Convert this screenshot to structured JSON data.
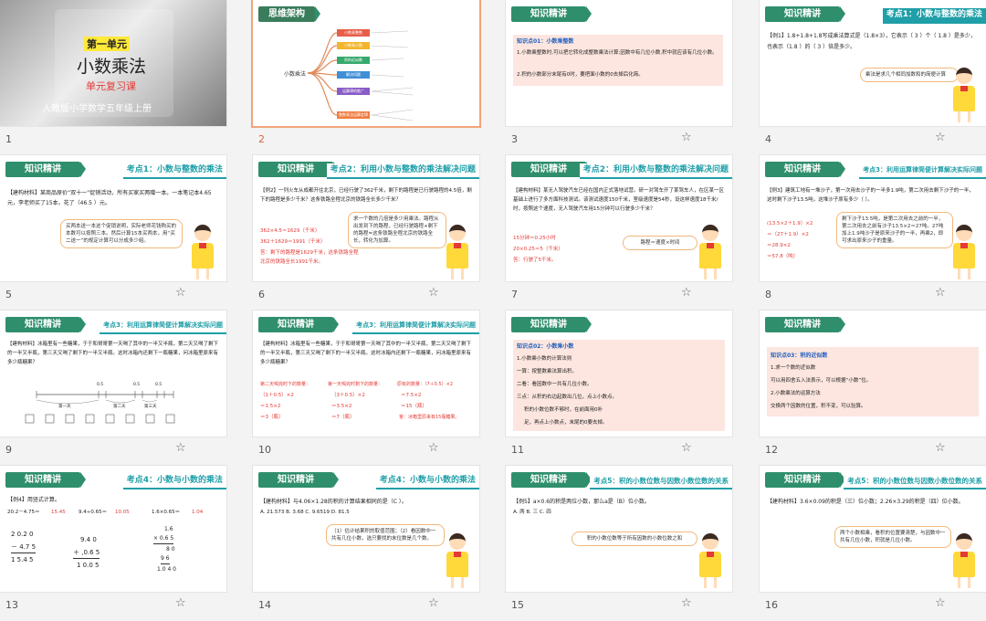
{
  "slides": [
    {
      "num": "1",
      "unit": "第一单元",
      "title": "小数乘法",
      "sub": "单元复习课",
      "pub": "人教版小学数学五年级上册"
    },
    {
      "num": "2",
      "header": "思维架构",
      "center": "小数乘法",
      "nodes": [
        "小数乘整数",
        "小数乘小数",
        "积的近似数",
        "解决问题",
        "运算律的推广",
        "整数乘法运算定律"
      ]
    },
    {
      "num": "3",
      "header": "知识精讲",
      "kp": "知识点01：小数乘整数",
      "lines": [
        "1.小数乘整数时,可以把它转化成整数乘法计算;因数中有几位小数,积中就应该有几位小数。",
        "2.积的小数部分末尾有0时，要把面小数的0去掉后化简。"
      ]
    },
    {
      "num": "4",
      "header": "知识精讲",
      "rtitle": "考点1：小数与整数的乘法",
      "q": "【例1】1.8+1.8+1.8写成乘法算式是（1.8×3），它表示（ 3 ）个（ 1.8 ）是多少，也表示（1.8 ）的（ 3 ）倍是多少。",
      "bubble": "乘法是求几个相同加数和的简便计算"
    },
    {
      "num": "5",
      "header": "知识精讲",
      "rtitle": "考点1：小数与整数的乘法",
      "q": "【建构材料】某商品原价“双十一”促销活动，所有买家买两赠一本。一本笔记本4.65元，李老师买了15本，花了（46.5 ）元。",
      "bubble": "买两本送一本这个促销说明，实际老师花钱购买的本数可以按照三本。然后计算15本买两本，用“买二送一”的规定计算可以分成多少组。"
    },
    {
      "num": "6",
      "header": "知识精讲",
      "rtitle": "考点2：利用小数与整数的乘法解决问题",
      "q": "【例2】一列火车从成都开往北京，已经行驶了362千米，剩下的路程是已行驶路程的4.5倍，剩下的路程是多少千米？这条铁路全程北京的铁路全长多少千米？",
      "a": [
        "362×4.5＝1629（千米）",
        "362＋1629＝1991（千米）",
        "答：剩下的路程是1629千米，这条铁路全程北京的铁路全长1991千米。"
      ],
      "bubble": "求一个数的几倍是多少用乘法。路程从出发到下的路程，已经行驶路程+剩下的路程=这条铁路全程北京的铁路全长，转化为加算。"
    },
    {
      "num": "7",
      "header": "知识精讲",
      "rtitle": "考点2：利用小数与整数的乘法解决问题",
      "q": "【建构材料】某无人驾驶汽车已经在国内正式落地试营。研一对驾车开了某驾车人，在区某一区基础上进行了多方面科技测试。该测试速度150千米，室级速度是54秒，设这样速度18千米/时，按照这个速度，无人驾驶汽车用15分钟可以行驶多少千米？",
      "a": [
        "15分钟＝0.25小时",
        "20×0.25＝5（千米）",
        "答：行驶了5千米。"
      ],
      "bubble": "路程＝速度×时间"
    },
    {
      "num": "8",
      "header": "知识精讲",
      "rtitle": "考点3：利用运算律简便计算解决实际问题",
      "q": "【例3】建筑工地有一堆沙子，第一次用去沙子的一半多1.9吨，第二次用去剩下沙子的一半，这时剩下沙子13.5吨，这堆沙子原有多少（ ）。",
      "a": [
        "(13.5×2＋1.9）×2",
        "＝（27＋1.9）×2",
        "＝28.9×2",
        "＝57.8（吨）"
      ],
      "bubble": "剩下沙子13.5吨，是第二次用去之前的一半，第二次用去之前有沙子13.5×2＝27吨。27吨加上1.9吨沙子是原来沙子的一半，再乘2，即可求出原来沙子的重量。"
    },
    {
      "num": "9",
      "header": "知识精讲",
      "rtitle": "考点3：利用运算律简便计算解决实际问题",
      "q": "【建构材料】冰箱里有一些糖果，于于和哥哥第一天喝了其中的一半又半瓶，第二天又喝了剩下的一半又半瓶，第三天又喝了剩下的一半又半瓶。这时冰箱内还剩下一瓶糖果，问冰箱里原来有多少瓶糖果？",
      "labels": [
        "第一天",
        "第二天",
        "第三天"
      ],
      "marks": [
        "0.5",
        "0.5",
        "0.5"
      ]
    },
    {
      "num": "10",
      "header": "知识精讲",
      "rtitle": "考点3：利用运算律简便计算解决实际问题",
      "q": "【建构材料】冰箱里有一些糖果，于于和哥哥第一天喝了其中的一半又半瓶，第二天又喝了剩下的一半又半瓶，第三天又喝了剩下的一半又半瓶。这时冰箱内还剩下一瓶糖果，问冰箱里原来有多少瓶糖果？",
      "c1": [
        "第二天喝完时下的数量：",
        "（1＋0.5）×2",
        "＝1.5×2",
        "＝3（瓶）"
      ],
      "c2": [
        "第一天喝完时剩下的数量：",
        "（3＋0.5）×2",
        "＝3.5×2",
        "＝7（瓶）"
      ],
      "c3": [
        "原有的数量：（7＋0.5）×2",
        "＝7.5×2",
        "＝15（瓶）",
        "答：冰箱里原来有15瓶糖果。"
      ]
    },
    {
      "num": "11",
      "header": "知识精讲",
      "kp": "知识点02：小数乘小数",
      "lines": [
        "1.小数乘小数的计算法则",
        "一算：按整数乘法算出积。",
        "二看：看因数中一共有几位小数。",
        "三点：从积的右边起数出几位，点上小数点。",
        "积的小数位数不够时，在前面用0补",
        "足，再点上小数点，末尾的0要去掉。"
      ]
    },
    {
      "num": "12",
      "header": "知识精讲",
      "kp": "知识点03：积的近似数",
      "lines": [
        "1.求一个数的近似数",
        "可以用四舍五入法表示，可以根据“小数”位。",
        "2.小数乘法的运算方法",
        "交换两个因数的位置，积不变，可以验算。"
      ]
    },
    {
      "num": "13",
      "header": "知识精讲",
      "rtitle": "考点4：小数与小数的乘法",
      "q": "【例4】用竖式计算。",
      "items": [
        "20.2－4.75＝",
        "15.45",
        "9.4÷0.65＝",
        "10.05",
        "1.6×0.65＝",
        "1.04"
      ],
      "v1": [
        "2 0.2 0",
        "－ 4.7 5",
        "1 5.4 5"
      ],
      "v2": [
        "9.4 0",
        "＋ ,0.6 5",
        "1 0.0 5"
      ],
      "v3": [
        "1.6",
        "× 0.6 5",
        "8 0",
        "9 6",
        "1.0 4 0"
      ]
    },
    {
      "num": "14",
      "header": "知识精讲",
      "rtitle": "考点4：小数与小数的乘法",
      "q": "【建构材料】与4.06×1.28的积的计算结果相同的是（C ）。",
      "opts": "A. 21.573 B. 3.68 C. 9.6519 D. 81.5",
      "bubble": "（1）估计结果积的取值范围；（2）看因数中一共有几位小数，选只要找的末位数是几个数。"
    },
    {
      "num": "15",
      "header": "知识精讲",
      "rtitle": "考点5：积的小数位数与因数小数位数的关系",
      "q": "【例5】a×0.6的积是两位小数，那么a是（B）位小数。",
      "opts": "A. 两 B. 三 C. 四",
      "bubble": "积的小数位数等于所有因数的小数位数之和"
    },
    {
      "num": "16",
      "header": "知识精讲",
      "rtitle": "考点5：积的小数位数与因数小数位数的关系",
      "q": "【建构材料】3.6×0.09的积是（三）位小数；2.26×3.29的积是（四）位小数。",
      "bubble": "两个小数相乘，看积的位置要清楚，与因数中一共有几位小数，积就是几位小数。"
    }
  ],
  "colors": {
    "accent": "#2f8f6d",
    "title": "#1f9fa8",
    "answer": "#e53935",
    "select": "#f2a37a"
  }
}
